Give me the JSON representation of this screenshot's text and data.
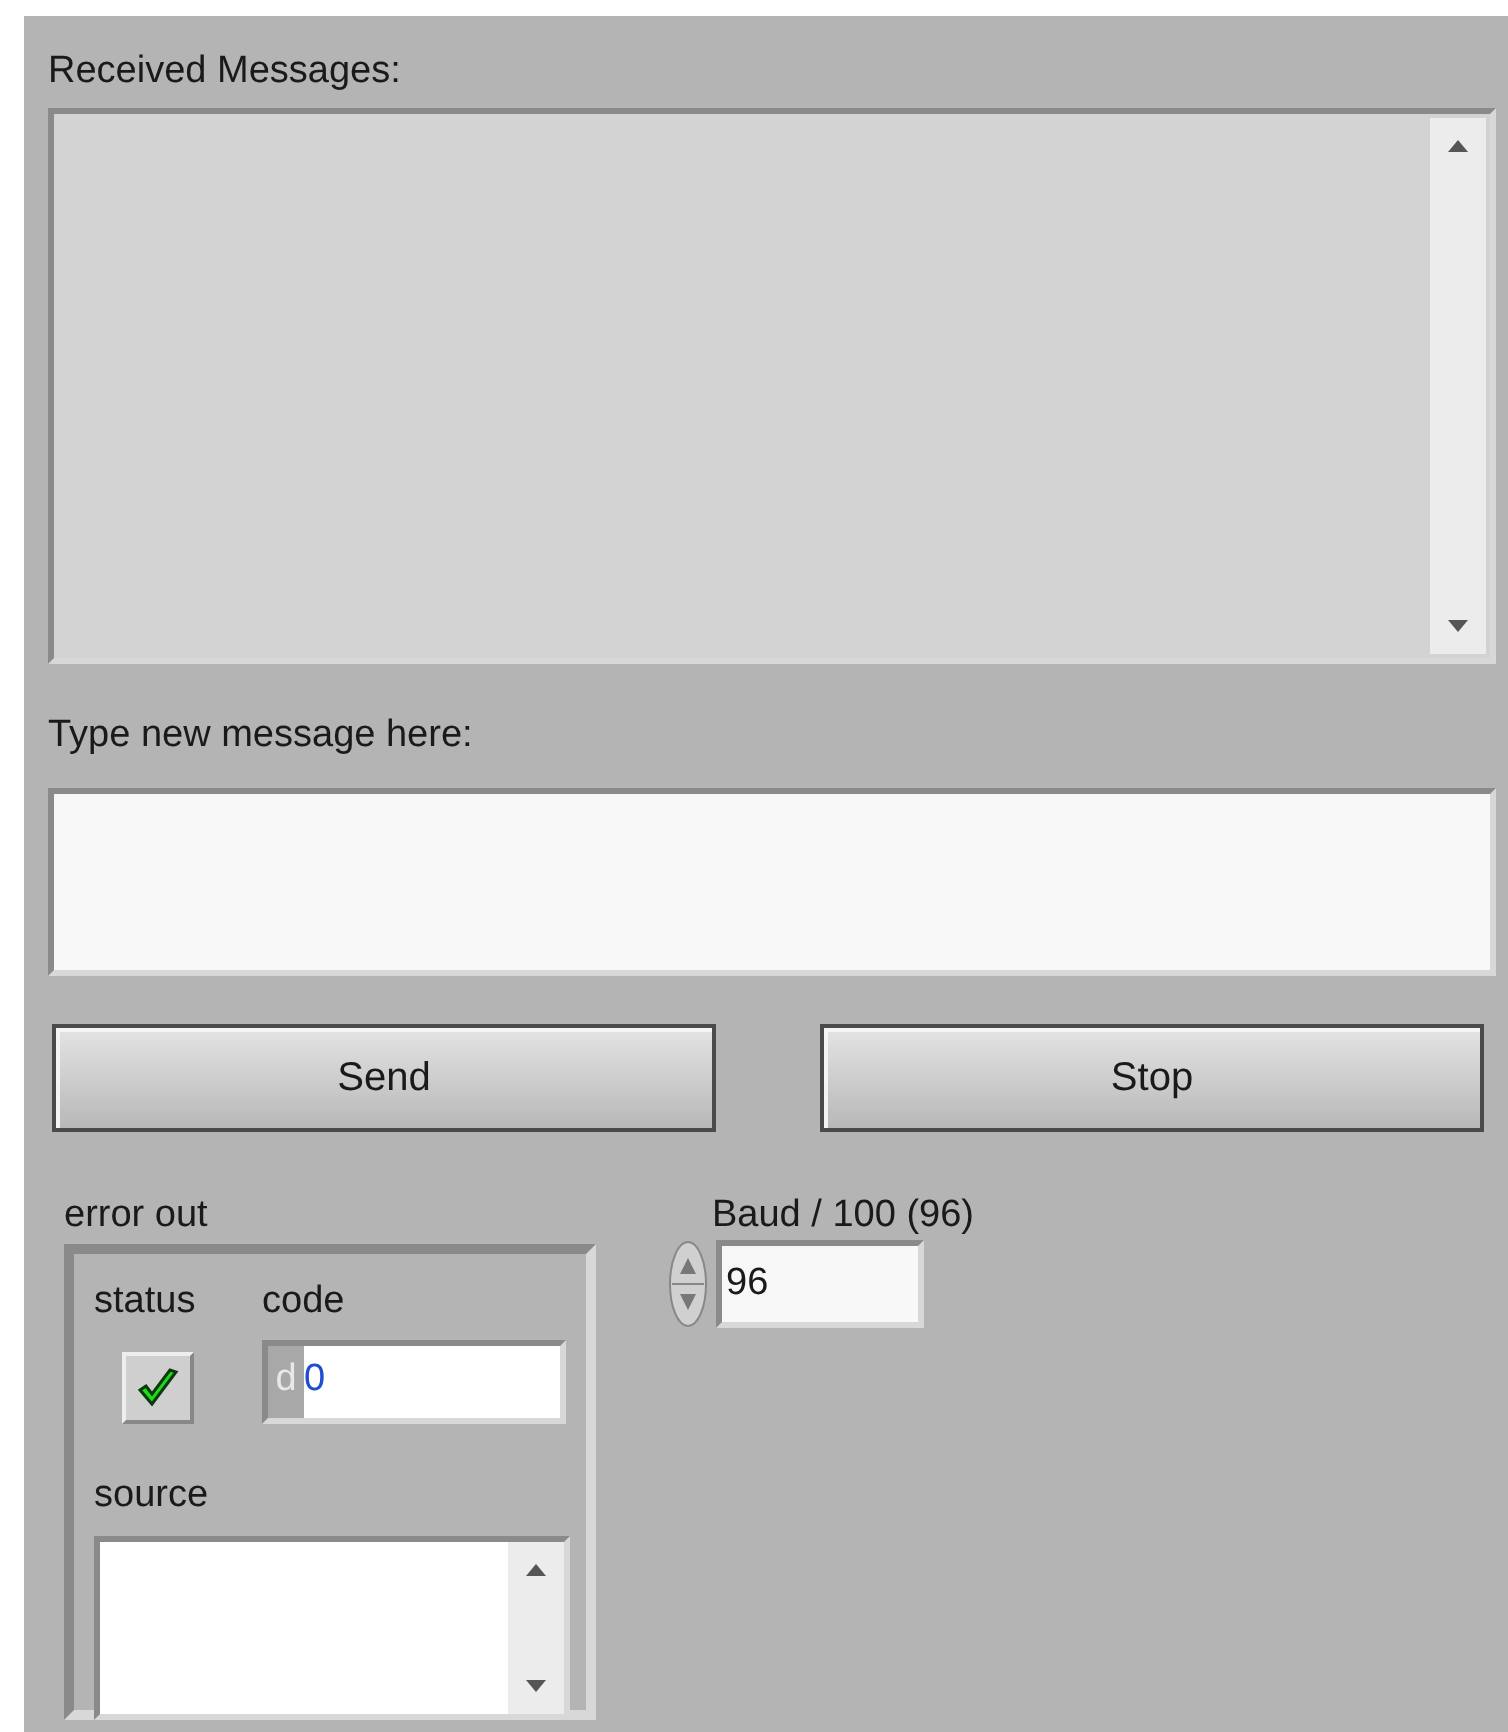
{
  "received_messages": {
    "label": "Received Messages:"
  },
  "new_message": {
    "label": "Type new message here:"
  },
  "buttons": [
    "Send",
    "Stop"
  ],
  "error_out": {
    "label": "error out",
    "status": {
      "label": "status",
      "checked": true
    },
    "code": {
      "label": "code",
      "radix": "d",
      "value": "0"
    },
    "source": {
      "label": "source"
    }
  },
  "baud": {
    "label": "Baud / 100 (96)",
    "value": "96"
  }
}
